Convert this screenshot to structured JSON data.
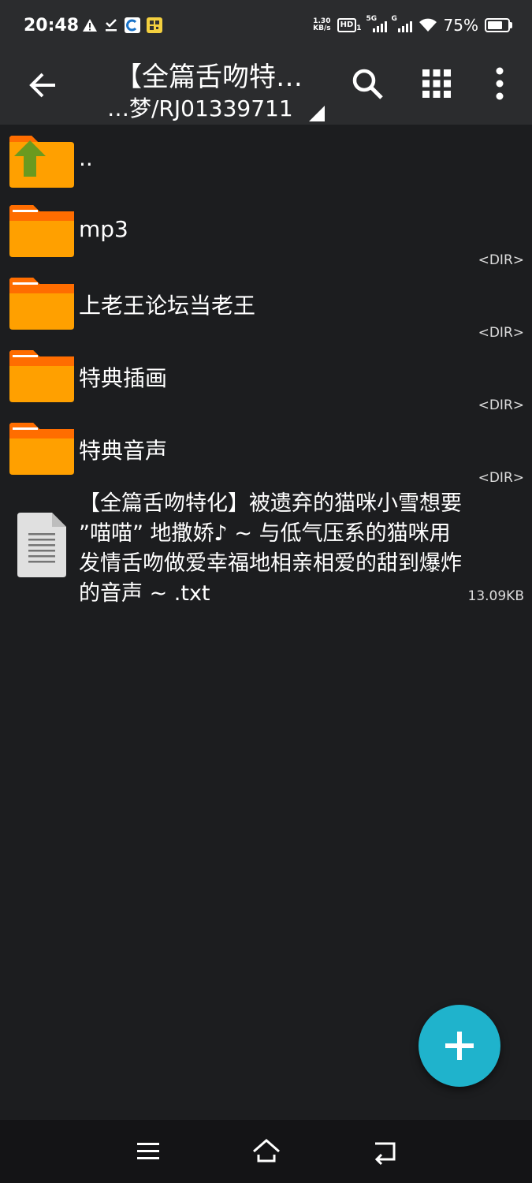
{
  "status_bar": {
    "time": "20:48",
    "net_speed_value": "1.30",
    "net_speed_unit": "KB/s",
    "hd_label": "HD",
    "hd_sub": "1",
    "sim1_label": "5G",
    "sim2_label": "G",
    "battery_percent": "75%",
    "battery_level": 0.75
  },
  "toolbar": {
    "title": "【全篇舌吻特…",
    "subtitle": "…梦/RJ01339711"
  },
  "files": {
    "up_dir_name": "..",
    "items": [
      {
        "name": "mp3",
        "meta": "<DIR>"
      },
      {
        "name": "上老王论坛当老王",
        "meta": "<DIR>"
      },
      {
        "name": "特典插画",
        "meta": "<DIR>"
      },
      {
        "name": "特典音声",
        "meta": "<DIR>"
      }
    ],
    "file": {
      "name": "【全篇舌吻特化】被遗弃的猫咪小雪想要 ”喵喵” 地撒娇♪ ~ 与低气压系的猫咪用发情舌吻做爱幸福地相亲相爱的甜到爆炸的音声 ~ .txt",
      "meta": "13.09KB"
    }
  },
  "colors": {
    "background": "#1c1d1f",
    "toolbar": "#2b2c2e",
    "folder": "#ffa000",
    "folder_tab": "#ff6d00",
    "fab": "#1fb3cc",
    "up_arrow": "#6a9a1f"
  }
}
